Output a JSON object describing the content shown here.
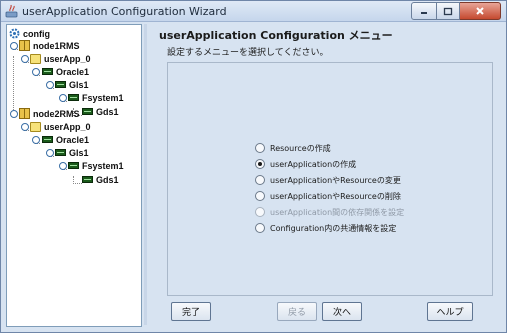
{
  "window": {
    "title": "userApplication Configuration Wizard"
  },
  "tree": {
    "root": "config",
    "nodes": [
      {
        "label": "node1RMS"
      },
      {
        "label": "userApp_0"
      },
      {
        "label": "Oracle1"
      },
      {
        "label": "Gls1"
      },
      {
        "label": "Fsystem1"
      },
      {
        "label": "Gds1"
      },
      {
        "label": "node2RMS"
      },
      {
        "label": "userApp_0"
      },
      {
        "label": "Oracle1"
      },
      {
        "label": "Gls1"
      },
      {
        "label": "Fsystem1"
      },
      {
        "label": "Gds1"
      }
    ]
  },
  "main": {
    "title": "userApplication Configuration メニュー",
    "instruction": "設定するメニューを選択してください。",
    "options": [
      {
        "label": "Resourceの作成",
        "selected": false,
        "enabled": true
      },
      {
        "label": "userApplicationの作成",
        "selected": true,
        "enabled": true
      },
      {
        "label": "userApplicationやResourceの変更",
        "selected": false,
        "enabled": true
      },
      {
        "label": "userApplicationやResourceの削除",
        "selected": false,
        "enabled": true
      },
      {
        "label": "userApplication間の依存関係を設定",
        "selected": false,
        "enabled": false
      },
      {
        "label": "Configuration内の共通情報を設定",
        "selected": false,
        "enabled": true
      }
    ]
  },
  "buttons": {
    "finish": "完了",
    "back": "戻る",
    "next": "次へ",
    "help": "ヘルプ"
  }
}
